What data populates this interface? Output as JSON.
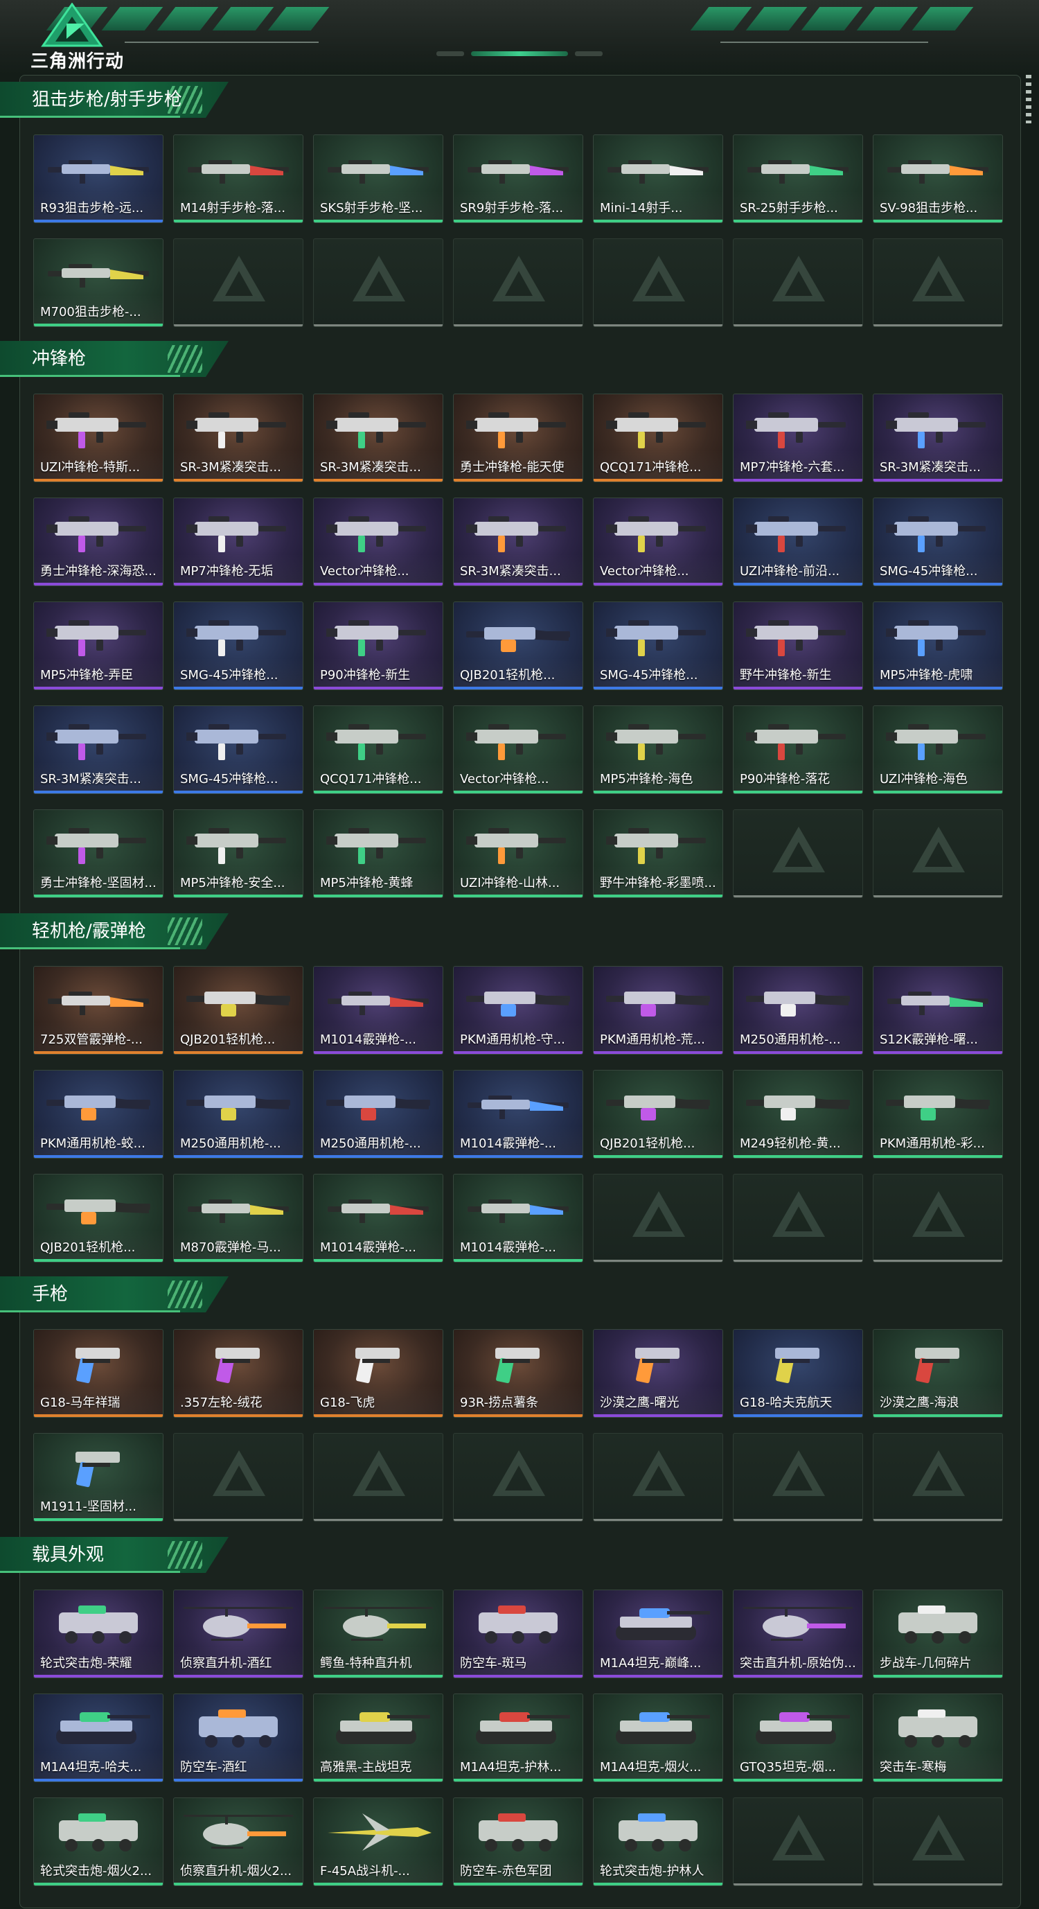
{
  "header": {
    "logo_text": "三角洲行动"
  },
  "colors": {
    "gold": "#e0812e",
    "purple": "#8b4bd9",
    "blue": "#3d79e6",
    "green": "#3fcf86",
    "accent": "#46c07a"
  },
  "sections": [
    {
      "title": "狙击步枪/射手步枪",
      "items": [
        {
          "label": "R93狙击步枪-远...",
          "quality": "blue",
          "icon": "sniper-rifle-icon"
        },
        {
          "label": "M14射手步枪-落...",
          "quality": "green",
          "icon": "marksman-rifle-icon"
        },
        {
          "label": "SKS射手步枪-坚...",
          "quality": "green",
          "icon": "marksman-rifle-icon"
        },
        {
          "label": "SR9射手步枪-落...",
          "quality": "green",
          "icon": "marksman-rifle-icon"
        },
        {
          "label": "Mini-14射手...",
          "quality": "green",
          "icon": "marksman-rifle-icon"
        },
        {
          "label": "SR-25射手步枪...",
          "quality": "green",
          "icon": "marksman-rifle-icon"
        },
        {
          "label": "SV-98狙击步枪...",
          "quality": "green",
          "icon": "sniper-rifle-icon"
        },
        {
          "label": "M700狙击步枪-...",
          "quality": "green",
          "icon": "sniper-rifle-icon"
        }
      ],
      "empty_slots": 6
    },
    {
      "title": "冲锋枪",
      "items": [
        {
          "label": "UZI冲锋枪-特斯...",
          "quality": "gold",
          "icon": "smg-icon"
        },
        {
          "label": "SR-3M紧凑突击...",
          "quality": "gold",
          "icon": "smg-icon"
        },
        {
          "label": "SR-3M紧凑突击...",
          "quality": "gold",
          "icon": "smg-icon"
        },
        {
          "label": "勇士冲锋枪-能天使",
          "quality": "gold",
          "icon": "smg-icon"
        },
        {
          "label": "QCQ171冲锋枪...",
          "quality": "gold",
          "icon": "smg-icon"
        },
        {
          "label": "MP7冲锋枪-六套...",
          "quality": "purple",
          "icon": "smg-icon"
        },
        {
          "label": "SR-3M紧凑突击...",
          "quality": "purple",
          "icon": "smg-icon"
        },
        {
          "label": "勇士冲锋枪-深海恐...",
          "quality": "purple",
          "icon": "smg-icon"
        },
        {
          "label": "MP7冲锋枪-无垢",
          "quality": "purple",
          "icon": "smg-icon"
        },
        {
          "label": "Vector冲锋枪...",
          "quality": "purple",
          "icon": "smg-icon"
        },
        {
          "label": "SR-3M紧凑突击...",
          "quality": "purple",
          "icon": "smg-icon"
        },
        {
          "label": "Vector冲锋枪...",
          "quality": "purple",
          "icon": "smg-icon"
        },
        {
          "label": "UZI冲锋枪-前沿...",
          "quality": "blue",
          "icon": "smg-icon"
        },
        {
          "label": "SMG-45冲锋枪...",
          "quality": "blue",
          "icon": "smg-icon"
        },
        {
          "label": "MP5冲锋枪-弄臣",
          "quality": "purple",
          "icon": "smg-icon"
        },
        {
          "label": "SMG-45冲锋枪...",
          "quality": "blue",
          "icon": "smg-icon"
        },
        {
          "label": "P90冲锋枪-新生",
          "quality": "purple",
          "icon": "smg-icon"
        },
        {
          "label": "QJB201轻机枪...",
          "quality": "blue",
          "icon": "lmg-icon"
        },
        {
          "label": "SMG-45冲锋枪...",
          "quality": "blue",
          "icon": "smg-icon"
        },
        {
          "label": "野牛冲锋枪-新生",
          "quality": "purple",
          "icon": "smg-icon"
        },
        {
          "label": "MP5冲锋枪-虎啸",
          "quality": "blue",
          "icon": "smg-icon"
        },
        {
          "label": "SR-3M紧凑突击...",
          "quality": "blue",
          "icon": "smg-icon"
        },
        {
          "label": "SMG-45冲锋枪...",
          "quality": "blue",
          "icon": "smg-icon"
        },
        {
          "label": "QCQ171冲锋枪...",
          "quality": "green",
          "icon": "smg-icon"
        },
        {
          "label": "Vector冲锋枪...",
          "quality": "green",
          "icon": "smg-icon"
        },
        {
          "label": "MP5冲锋枪-海色",
          "quality": "green",
          "icon": "smg-icon"
        },
        {
          "label": "P90冲锋枪-落花",
          "quality": "green",
          "icon": "smg-icon"
        },
        {
          "label": "UZI冲锋枪-海色",
          "quality": "green",
          "icon": "smg-icon"
        },
        {
          "label": "勇士冲锋枪-坚固材...",
          "quality": "green",
          "icon": "smg-icon"
        },
        {
          "label": "MP5冲锋枪-安全...",
          "quality": "green",
          "icon": "smg-icon"
        },
        {
          "label": "MP5冲锋枪-黄蜂",
          "quality": "green",
          "icon": "smg-icon"
        },
        {
          "label": "UZI冲锋枪-山林...",
          "quality": "green",
          "icon": "smg-icon"
        },
        {
          "label": "野牛冲锋枪-彩墨喷...",
          "quality": "green",
          "icon": "smg-icon"
        }
      ],
      "empty_slots": 2
    },
    {
      "title": "轻机枪/霰弹枪",
      "items": [
        {
          "label": "725双管霰弹枪-...",
          "quality": "gold",
          "icon": "shotgun-icon"
        },
        {
          "label": "QJB201轻机枪...",
          "quality": "gold",
          "icon": "lmg-icon"
        },
        {
          "label": "M1014霰弹枪-...",
          "quality": "purple",
          "icon": "shotgun-icon"
        },
        {
          "label": "PKM通用机枪-守...",
          "quality": "purple",
          "icon": "lmg-icon"
        },
        {
          "label": "PKM通用机枪-荒...",
          "quality": "purple",
          "icon": "lmg-icon"
        },
        {
          "label": "M250通用机枪-...",
          "quality": "purple",
          "icon": "lmg-icon"
        },
        {
          "label": "S12K霰弹枪-曙...",
          "quality": "purple",
          "icon": "shotgun-icon"
        },
        {
          "label": "PKM通用机枪-蛟...",
          "quality": "blue",
          "icon": "lmg-icon"
        },
        {
          "label": "M250通用机枪-...",
          "quality": "blue",
          "icon": "lmg-icon"
        },
        {
          "label": "M250通用机枪-...",
          "quality": "blue",
          "icon": "lmg-icon"
        },
        {
          "label": "M1014霰弹枪-...",
          "quality": "blue",
          "icon": "shotgun-icon"
        },
        {
          "label": "QJB201轻机枪...",
          "quality": "green",
          "icon": "lmg-icon"
        },
        {
          "label": "M249轻机枪-黄...",
          "quality": "green",
          "icon": "lmg-icon"
        },
        {
          "label": "PKM通用机枪-彩...",
          "quality": "green",
          "icon": "lmg-icon"
        },
        {
          "label": "QJB201轻机枪...",
          "quality": "green",
          "icon": "lmg-icon"
        },
        {
          "label": "M870霰弹枪-马...",
          "quality": "green",
          "icon": "shotgun-icon"
        },
        {
          "label": "M1014霰弹枪-...",
          "quality": "green",
          "icon": "shotgun-icon"
        },
        {
          "label": "M1014霰弹枪-...",
          "quality": "green",
          "icon": "shotgun-icon"
        }
      ],
      "empty_slots": 3
    },
    {
      "title": "手枪",
      "items": [
        {
          "label": "G18-马年祥瑞",
          "quality": "gold",
          "icon": "pistol-icon"
        },
        {
          "label": ".357左轮-绒花",
          "quality": "gold",
          "icon": "revolver-icon"
        },
        {
          "label": "G18-飞虎",
          "quality": "gold",
          "icon": "pistol-icon"
        },
        {
          "label": "93R-捞点薯条",
          "quality": "gold",
          "icon": "pistol-icon"
        },
        {
          "label": "沙漠之鹰-曙光",
          "quality": "purple",
          "icon": "pistol-icon"
        },
        {
          "label": "G18-哈夫克航天",
          "quality": "blue",
          "icon": "pistol-icon"
        },
        {
          "label": "沙漠之鹰-海浪",
          "quality": "green",
          "icon": "pistol-icon"
        },
        {
          "label": "M1911-坚固材...",
          "quality": "green",
          "icon": "pistol-icon"
        }
      ],
      "empty_slots": 6
    },
    {
      "title": "载具外观",
      "items": [
        {
          "label": "轮式突击炮-荣耀",
          "quality": "purple",
          "icon": "armored-car-icon"
        },
        {
          "label": "侦察直升机-酒红",
          "quality": "purple",
          "icon": "helicopter-icon"
        },
        {
          "label": "鳄鱼-特种直升机",
          "quality": "green",
          "icon": "helicopter-icon"
        },
        {
          "label": "防空车-斑马",
          "quality": "purple",
          "icon": "armored-car-icon"
        },
        {
          "label": "M1A4坦克-巅峰...",
          "quality": "purple",
          "icon": "tank-icon"
        },
        {
          "label": "突击直升机-原始伪...",
          "quality": "purple",
          "icon": "helicopter-icon"
        },
        {
          "label": "步战车-几何碎片",
          "quality": "green",
          "icon": "armored-car-icon"
        },
        {
          "label": "M1A4坦克-哈夫...",
          "quality": "blue",
          "icon": "tank-icon"
        },
        {
          "label": "防空车-酒红",
          "quality": "blue",
          "icon": "armored-car-icon"
        },
        {
          "label": "高雅黑-主战坦克",
          "quality": "green",
          "icon": "tank-icon"
        },
        {
          "label": "M1A4坦克-护林...",
          "quality": "green",
          "icon": "tank-icon"
        },
        {
          "label": "M1A4坦克-烟火...",
          "quality": "green",
          "icon": "tank-icon"
        },
        {
          "label": "GTQ35坦克-烟...",
          "quality": "green",
          "icon": "tank-icon"
        },
        {
          "label": "突击车-寒梅",
          "quality": "green",
          "icon": "armored-car-icon"
        },
        {
          "label": "轮式突击炮-烟火2...",
          "quality": "green",
          "icon": "armored-car-icon"
        },
        {
          "label": "侦察直升机-烟火2...",
          "quality": "green",
          "icon": "helicopter-icon"
        },
        {
          "label": "F-45A战斗机-...",
          "quality": "green",
          "icon": "jet-fighter-icon"
        },
        {
          "label": "防空车-赤色军团",
          "quality": "green",
          "icon": "armored-car-icon"
        },
        {
          "label": "轮式突击炮-护林人",
          "quality": "green",
          "icon": "armored-car-icon"
        }
      ],
      "empty_slots": 2
    }
  ]
}
